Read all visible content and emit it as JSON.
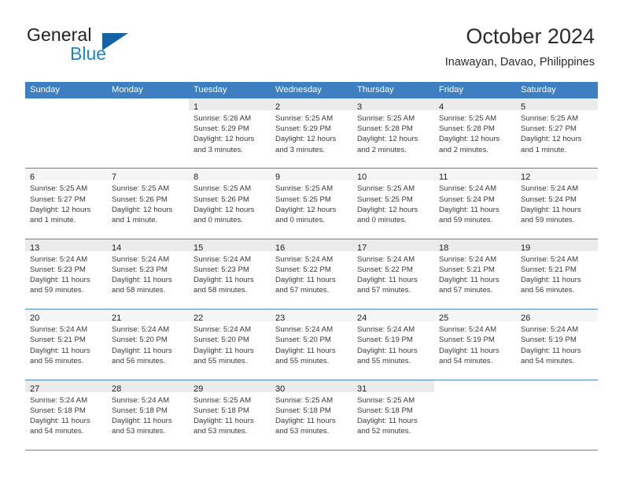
{
  "brand": {
    "name_part1": "General",
    "name_part2": "Blue",
    "triangle_color": "#1463a5",
    "blue_color": "#1b87c9"
  },
  "header": {
    "month_title": "October 2024",
    "location": "Inawayan, Davao, Philippines"
  },
  "theme": {
    "header_row_bg": "#3d7fc1",
    "header_row_text": "#ffffff",
    "daynum_bar_bg": "#f0f0f0",
    "row_border": "#4b87c6",
    "cell_text": "#3a3a3a"
  },
  "weekdays": [
    "Sunday",
    "Monday",
    "Tuesday",
    "Wednesday",
    "Thursday",
    "Friday",
    "Saturday"
  ],
  "weeks": [
    {
      "shaded": true,
      "days": [
        {
          "num": "",
          "lines": []
        },
        {
          "num": "",
          "lines": []
        },
        {
          "num": "1",
          "lines": [
            "Sunrise: 5:26 AM",
            "Sunset: 5:29 PM",
            "Daylight: 12 hours",
            "and 3 minutes."
          ]
        },
        {
          "num": "2",
          "lines": [
            "Sunrise: 5:25 AM",
            "Sunset: 5:29 PM",
            "Daylight: 12 hours",
            "and 3 minutes."
          ]
        },
        {
          "num": "3",
          "lines": [
            "Sunrise: 5:25 AM",
            "Sunset: 5:28 PM",
            "Daylight: 12 hours",
            "and 2 minutes."
          ]
        },
        {
          "num": "4",
          "lines": [
            "Sunrise: 5:25 AM",
            "Sunset: 5:28 PM",
            "Daylight: 12 hours",
            "and 2 minutes."
          ]
        },
        {
          "num": "5",
          "lines": [
            "Sunrise: 5:25 AM",
            "Sunset: 5:27 PM",
            "Daylight: 12 hours",
            "and 1 minute."
          ]
        }
      ]
    },
    {
      "shaded": false,
      "days": [
        {
          "num": "6",
          "lines": [
            "Sunrise: 5:25 AM",
            "Sunset: 5:27 PM",
            "Daylight: 12 hours",
            "and 1 minute."
          ]
        },
        {
          "num": "7",
          "lines": [
            "Sunrise: 5:25 AM",
            "Sunset: 5:26 PM",
            "Daylight: 12 hours",
            "and 1 minute."
          ]
        },
        {
          "num": "8",
          "lines": [
            "Sunrise: 5:25 AM",
            "Sunset: 5:26 PM",
            "Daylight: 12 hours",
            "and 0 minutes."
          ]
        },
        {
          "num": "9",
          "lines": [
            "Sunrise: 5:25 AM",
            "Sunset: 5:25 PM",
            "Daylight: 12 hours",
            "and 0 minutes."
          ]
        },
        {
          "num": "10",
          "lines": [
            "Sunrise: 5:25 AM",
            "Sunset: 5:25 PM",
            "Daylight: 12 hours",
            "and 0 minutes."
          ]
        },
        {
          "num": "11",
          "lines": [
            "Sunrise: 5:24 AM",
            "Sunset: 5:24 PM",
            "Daylight: 11 hours",
            "and 59 minutes."
          ]
        },
        {
          "num": "12",
          "lines": [
            "Sunrise: 5:24 AM",
            "Sunset: 5:24 PM",
            "Daylight: 11 hours",
            "and 59 minutes."
          ]
        }
      ]
    },
    {
      "shaded": true,
      "days": [
        {
          "num": "13",
          "lines": [
            "Sunrise: 5:24 AM",
            "Sunset: 5:23 PM",
            "Daylight: 11 hours",
            "and 59 minutes."
          ]
        },
        {
          "num": "14",
          "lines": [
            "Sunrise: 5:24 AM",
            "Sunset: 5:23 PM",
            "Daylight: 11 hours",
            "and 58 minutes."
          ]
        },
        {
          "num": "15",
          "lines": [
            "Sunrise: 5:24 AM",
            "Sunset: 5:23 PM",
            "Daylight: 11 hours",
            "and 58 minutes."
          ]
        },
        {
          "num": "16",
          "lines": [
            "Sunrise: 5:24 AM",
            "Sunset: 5:22 PM",
            "Daylight: 11 hours",
            "and 57 minutes."
          ]
        },
        {
          "num": "17",
          "lines": [
            "Sunrise: 5:24 AM",
            "Sunset: 5:22 PM",
            "Daylight: 11 hours",
            "and 57 minutes."
          ]
        },
        {
          "num": "18",
          "lines": [
            "Sunrise: 5:24 AM",
            "Sunset: 5:21 PM",
            "Daylight: 11 hours",
            "and 57 minutes."
          ]
        },
        {
          "num": "19",
          "lines": [
            "Sunrise: 5:24 AM",
            "Sunset: 5:21 PM",
            "Daylight: 11 hours",
            "and 56 minutes."
          ]
        }
      ]
    },
    {
      "shaded": false,
      "days": [
        {
          "num": "20",
          "lines": [
            "Sunrise: 5:24 AM",
            "Sunset: 5:21 PM",
            "Daylight: 11 hours",
            "and 56 minutes."
          ]
        },
        {
          "num": "21",
          "lines": [
            "Sunrise: 5:24 AM",
            "Sunset: 5:20 PM",
            "Daylight: 11 hours",
            "and 56 minutes."
          ]
        },
        {
          "num": "22",
          "lines": [
            "Sunrise: 5:24 AM",
            "Sunset: 5:20 PM",
            "Daylight: 11 hours",
            "and 55 minutes."
          ]
        },
        {
          "num": "23",
          "lines": [
            "Sunrise: 5:24 AM",
            "Sunset: 5:20 PM",
            "Daylight: 11 hours",
            "and 55 minutes."
          ]
        },
        {
          "num": "24",
          "lines": [
            "Sunrise: 5:24 AM",
            "Sunset: 5:19 PM",
            "Daylight: 11 hours",
            "and 55 minutes."
          ]
        },
        {
          "num": "25",
          "lines": [
            "Sunrise: 5:24 AM",
            "Sunset: 5:19 PM",
            "Daylight: 11 hours",
            "and 54 minutes."
          ]
        },
        {
          "num": "26",
          "lines": [
            "Sunrise: 5:24 AM",
            "Sunset: 5:19 PM",
            "Daylight: 11 hours",
            "and 54 minutes."
          ]
        }
      ]
    },
    {
      "shaded": true,
      "days": [
        {
          "num": "27",
          "lines": [
            "Sunrise: 5:24 AM",
            "Sunset: 5:18 PM",
            "Daylight: 11 hours",
            "and 54 minutes."
          ]
        },
        {
          "num": "28",
          "lines": [
            "Sunrise: 5:24 AM",
            "Sunset: 5:18 PM",
            "Daylight: 11 hours",
            "and 53 minutes."
          ]
        },
        {
          "num": "29",
          "lines": [
            "Sunrise: 5:25 AM",
            "Sunset: 5:18 PM",
            "Daylight: 11 hours",
            "and 53 minutes."
          ]
        },
        {
          "num": "30",
          "lines": [
            "Sunrise: 5:25 AM",
            "Sunset: 5:18 PM",
            "Daylight: 11 hours",
            "and 53 minutes."
          ]
        },
        {
          "num": "31",
          "lines": [
            "Sunrise: 5:25 AM",
            "Sunset: 5:18 PM",
            "Daylight: 11 hours",
            "and 52 minutes."
          ]
        },
        {
          "num": "",
          "lines": []
        },
        {
          "num": "",
          "lines": []
        }
      ]
    }
  ]
}
